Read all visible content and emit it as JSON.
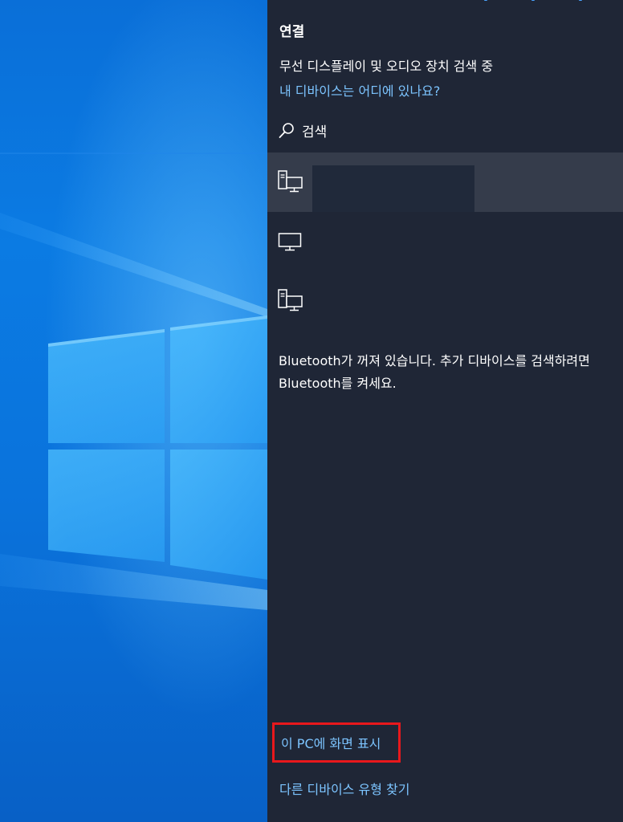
{
  "desktop": {
    "wallpaper": "windows-10-logo-light-beams",
    "colors": {
      "base": "#0a6fd8",
      "glow": "#6ec8ff"
    }
  },
  "connect_panel": {
    "title": "연결",
    "status_text": "무선 디스플레이 및 오디오 장치 검색 중",
    "help_link": "내 디바이스는 어디에 있나요?",
    "search_label": "검색",
    "search_icon": "search-icon",
    "devices": [
      {
        "icon": "pc-connect-icon",
        "name": "",
        "selected": true
      },
      {
        "icon": "monitor-icon",
        "name": "",
        "selected": false
      },
      {
        "icon": "pc-connect-icon",
        "name": "",
        "selected": false
      }
    ],
    "bluetooth_message": "Bluetooth가 꺼져 있습니다. 추가 디바이스를 검색하려면 Bluetooth를 켜세요.",
    "project_link": "이 PC에 화면 표시",
    "other_devices_link": "다른 디바이스 유형 찾기",
    "colors": {
      "panel_bg": "#1f2636",
      "selected_bg": "#353c4b",
      "link": "#7cc4ff",
      "highlight_border": "#e8181c"
    }
  }
}
